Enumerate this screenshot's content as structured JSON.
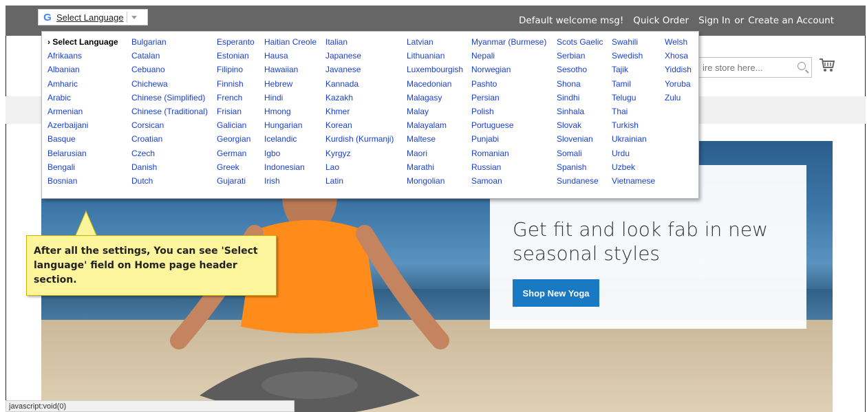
{
  "translate": {
    "select_label": "Select Language",
    "languages": [
      [
        "› Select Language",
        "Afrikaans",
        "Albanian",
        "Amharic",
        "Arabic",
        "Armenian",
        "Azerbaijani",
        "Basque",
        "Belarusian",
        "Bengali",
        "Bosnian"
      ],
      [
        "Bulgarian",
        "Catalan",
        "Cebuano",
        "Chichewa",
        "Chinese (Simplified)",
        "Chinese (Traditional)",
        "Corsican",
        "Croatian",
        "Czech",
        "Danish",
        "Dutch"
      ],
      [
        "Esperanto",
        "Estonian",
        "Filipino",
        "Finnish",
        "French",
        "Frisian",
        "Galician",
        "Georgian",
        "German",
        "Greek",
        "Gujarati"
      ],
      [
        "Haitian Creole",
        "Hausa",
        "Hawaiian",
        "Hebrew",
        "Hindi",
        "Hmong",
        "Hungarian",
        "Icelandic",
        "Igbo",
        "Indonesian",
        "Irish"
      ],
      [
        "Italian",
        "Japanese",
        "Javanese",
        "Kannada",
        "Kazakh",
        "Khmer",
        "Korean",
        "Kurdish (Kurmanji)",
        "Kyrgyz",
        "Lao",
        "Latin"
      ],
      [
        "Latvian",
        "Lithuanian",
        "Luxembourgish",
        "Macedonian",
        "Malagasy",
        "Malay",
        "Malayalam",
        "Maltese",
        "Maori",
        "Marathi",
        "Mongolian"
      ],
      [
        "Myanmar (Burmese)",
        "Nepali",
        "Norwegian",
        "Pashto",
        "Persian",
        "Polish",
        "Portuguese",
        "Punjabi",
        "Romanian",
        "Russian",
        "Samoan"
      ],
      [
        "Scots Gaelic",
        "Serbian",
        "Sesotho",
        "Shona",
        "Sindhi",
        "Sinhala",
        "Slovak",
        "Slovenian",
        "Somali",
        "Spanish",
        "Sundanese"
      ],
      [
        "Swahili",
        "Swedish",
        "Tajik",
        "Tamil",
        "Telugu",
        "Thai",
        "Turkish",
        "Ukrainian",
        "Urdu",
        "Uzbek",
        "Vietnamese"
      ],
      [
        "Welsh",
        "Xhosa",
        "Yiddish",
        "Yoruba",
        "Zulu"
      ]
    ]
  },
  "header": {
    "welcome": "Default welcome msg!",
    "quick_order": "Quick Order",
    "sign_in": "Sign In",
    "or": "or",
    "create_account": "Create an Account"
  },
  "search": {
    "placeholder": "ire store here..."
  },
  "hero": {
    "title": "Get fit and look fab in new seasonal styles",
    "button": "Shop New Yoga"
  },
  "callout": {
    "text": "After all the settings, You can see 'Select language' field on Home page header section."
  },
  "status_bar": {
    "text": "javascript:void(0)"
  },
  "colors": {
    "header_bg": "#666666",
    "link_blue": "#1a3fcf",
    "button_blue": "#1979c3",
    "callout_yellow": "#fdf59c"
  }
}
